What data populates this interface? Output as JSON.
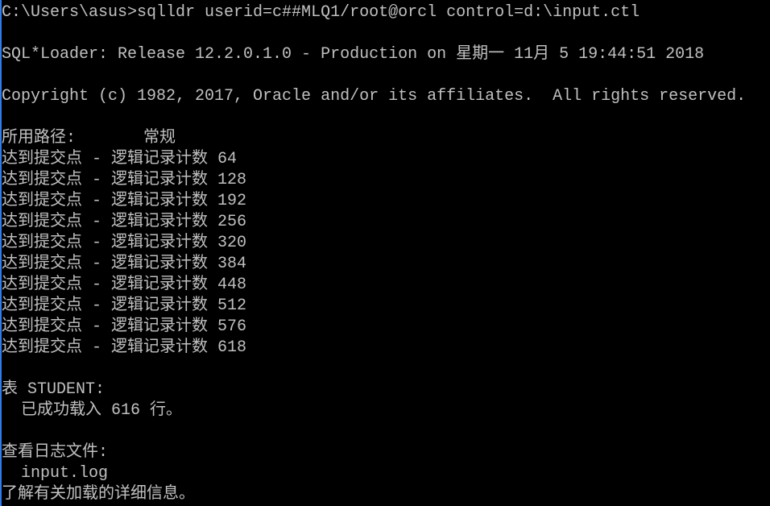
{
  "console": {
    "lines": [
      "C:\\Users\\asus>sqlldr userid=c##MLQ1/root@orcl control=d:\\input.ctl",
      "",
      "SQL*Loader: Release 12.2.0.1.0 - Production on 星期一 11月 5 19:44:51 2018",
      "",
      "Copyright (c) 1982, 2017, Oracle and/or its affiliates.  All rights reserved.",
      "",
      "所用路径:       常规",
      "达到提交点 - 逻辑记录计数 64",
      "达到提交点 - 逻辑记录计数 128",
      "达到提交点 - 逻辑记录计数 192",
      "达到提交点 - 逻辑记录计数 256",
      "达到提交点 - 逻辑记录计数 320",
      "达到提交点 - 逻辑记录计数 384",
      "达到提交点 - 逻辑记录计数 448",
      "达到提交点 - 逻辑记录计数 512",
      "达到提交点 - 逻辑记录计数 576",
      "达到提交点 - 逻辑记录计数 618",
      "",
      "表 STUDENT:",
      "  已成功载入 616 行。",
      "",
      "查看日志文件:",
      "  input.log",
      "了解有关加载的详细信息。"
    ],
    "colors": {
      "background": "#000000",
      "text": "#c0c0c0"
    }
  }
}
